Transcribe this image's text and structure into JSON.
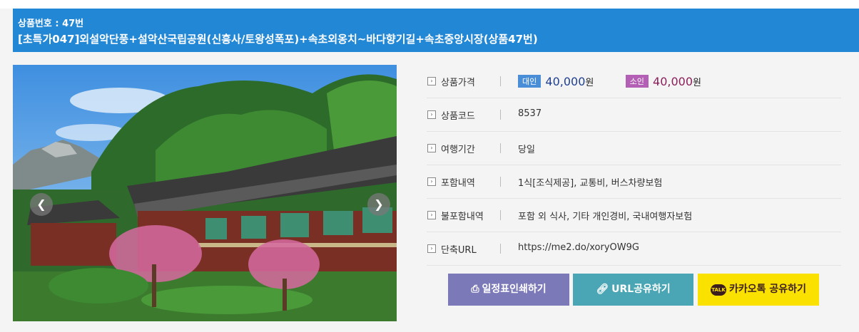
{
  "header": {
    "product_no": "상품번호 : 47번",
    "title": "[초특가047]외설악단풍+설악산국립공원(신흥사/토왕성폭포)+속초외옹치~바다향기길+속초중앙시장(상품47번)"
  },
  "gallery": {
    "prev_icon": "chevron-left-icon",
    "next_icon": "chevron-right-icon"
  },
  "info": {
    "price": {
      "label": "상품가격",
      "adult_badge": "대인",
      "adult_amount": "40,000",
      "adult_unit": "원",
      "child_badge": "소인",
      "child_amount": "40,000",
      "child_unit": "원"
    },
    "code": {
      "label": "상품코드",
      "value": "8537"
    },
    "period": {
      "label": "여행기간",
      "value": "당일"
    },
    "included": {
      "label": "포함내역",
      "value": "1식[조식제공], 교통비, 버스차량보험"
    },
    "excluded": {
      "label": "불포함내역",
      "value": "포함 외 식사, 기타 개인경비, 국내여행자보험"
    },
    "short_url": {
      "label": "단축URL",
      "value": "https://me2.do/xoryOW9G"
    }
  },
  "buttons": {
    "print": "일정표인쇄하기",
    "url_share": "URL공유하기",
    "kakao_share": "카카오톡 공유하기",
    "kakao_icon_text": "TALK"
  },
  "colors": {
    "header_bg": "#2287d4",
    "adult_badge": "#4a8ed8",
    "child_badge": "#b35fb5",
    "print_button": "#7c79b8",
    "url_button": "#4aa6b4",
    "kakao_button": "#fae100"
  }
}
